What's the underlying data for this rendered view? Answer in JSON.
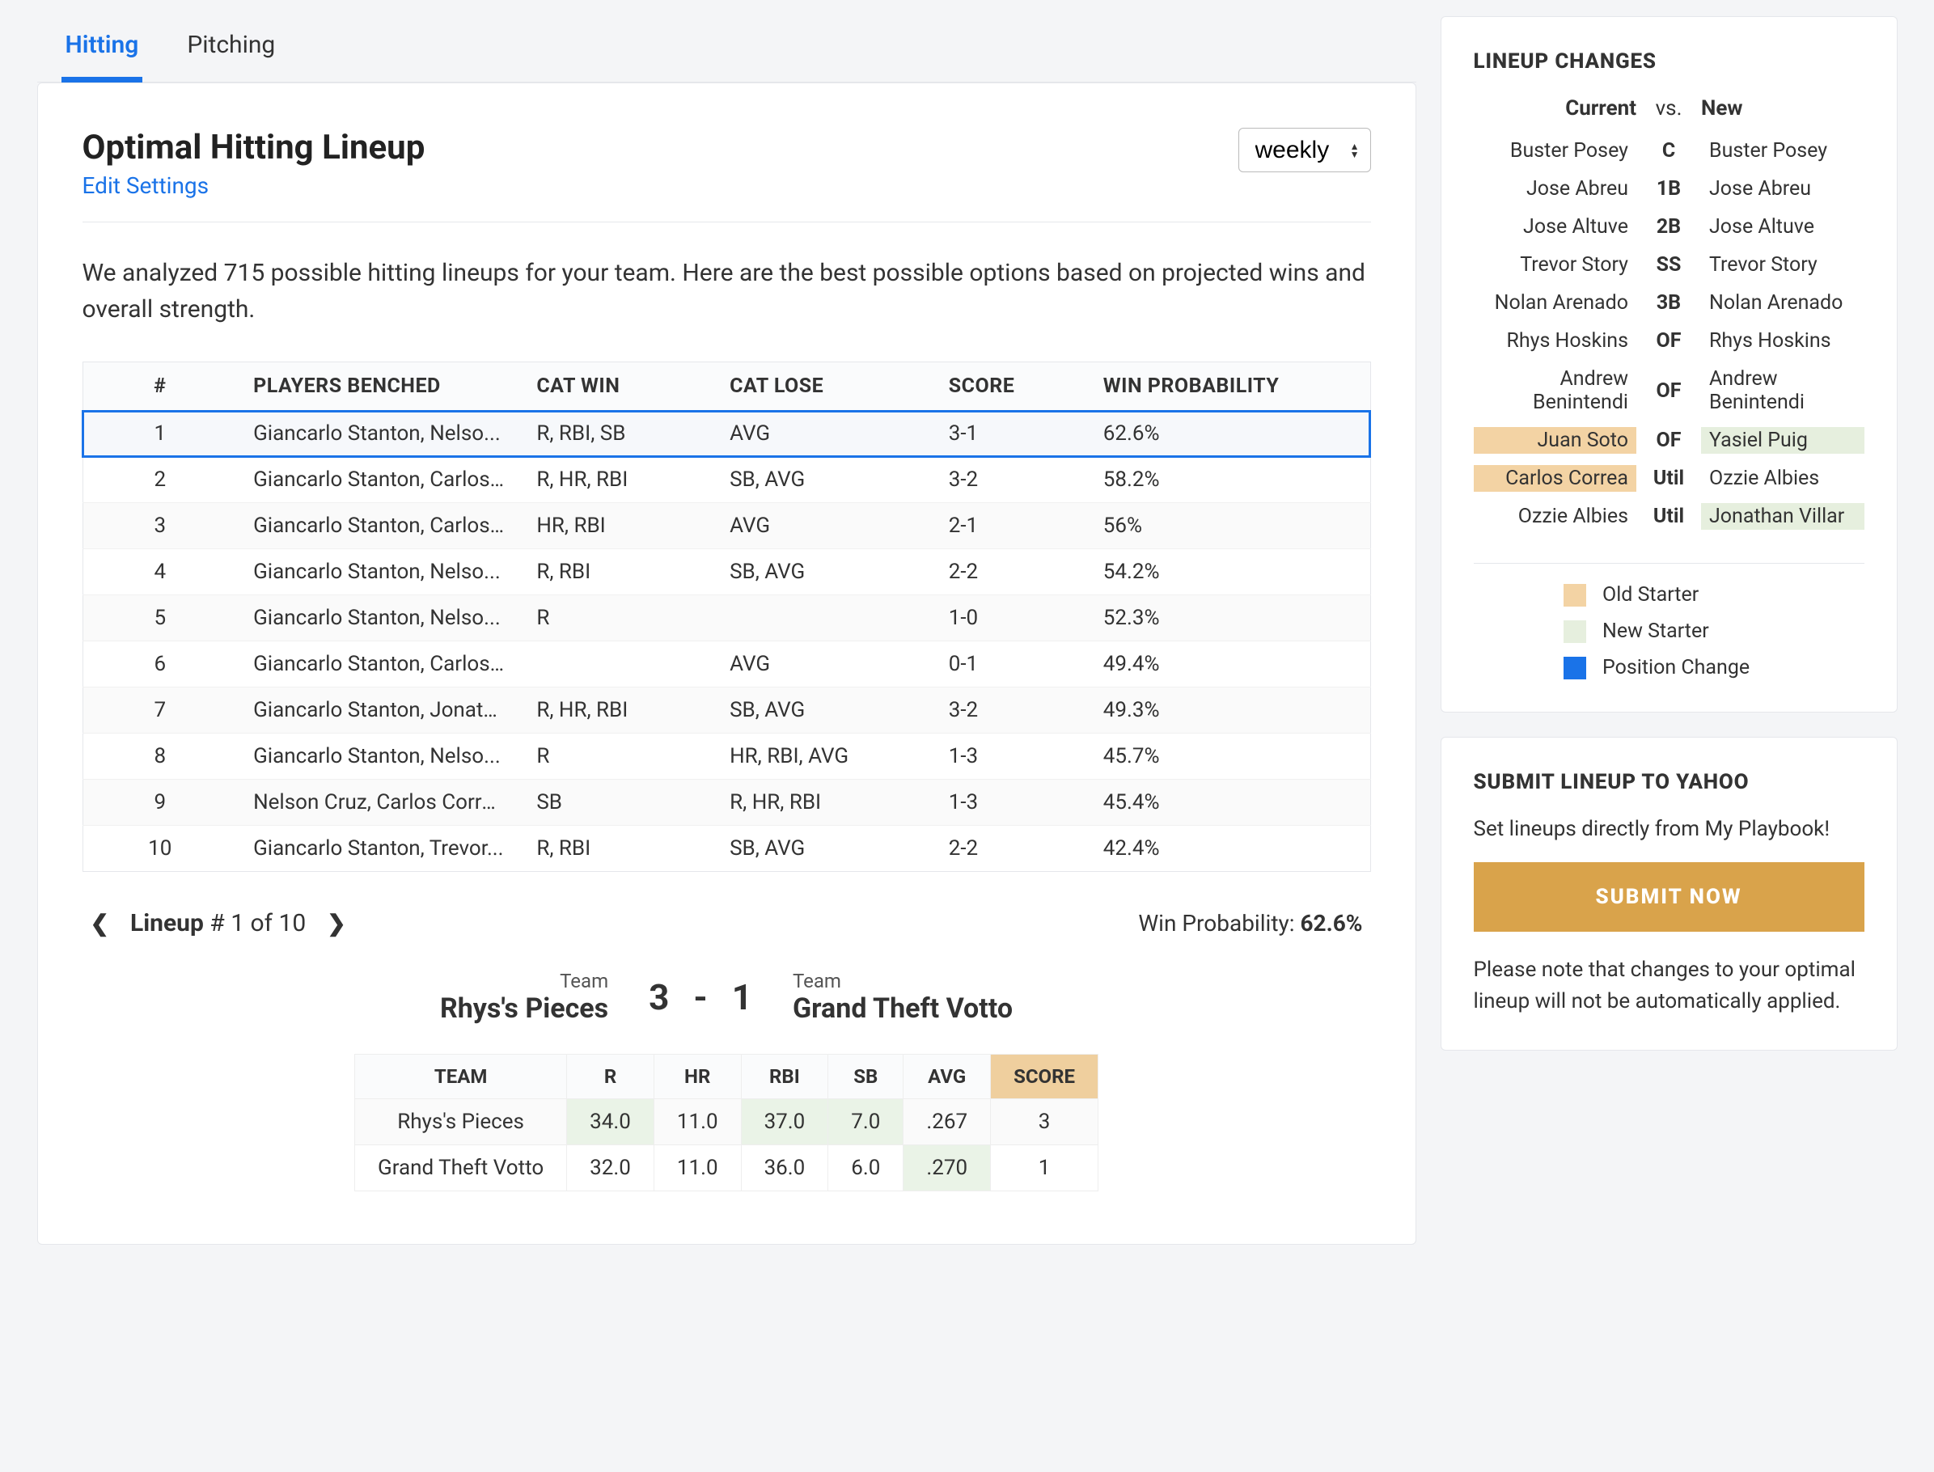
{
  "tabs": {
    "hitting": "Hitting",
    "pitching": "Pitching"
  },
  "title": "Optimal Hitting Lineup",
  "edit_link": "Edit Settings",
  "frequency": "weekly",
  "analysis_text": "We analyzed 715 possible hitting lineups for your team. Here are the best possible options based on projected wins and overall strength.",
  "table": {
    "headers": {
      "num": "#",
      "players": "PLAYERS BENCHED",
      "win": "CAT WIN",
      "lose": "CAT LOSE",
      "score": "SCORE",
      "prob": "WIN PROBABILITY"
    },
    "rows": [
      {
        "num": "1",
        "players": "Giancarlo Stanton, Nelso...",
        "win": "R, RBI, SB",
        "lose": "AVG",
        "score": "3-1",
        "prob": "62.6%"
      },
      {
        "num": "2",
        "players": "Giancarlo Stanton, Carlos...",
        "win": "R, HR, RBI",
        "lose": "SB, AVG",
        "score": "3-2",
        "prob": "58.2%"
      },
      {
        "num": "3",
        "players": "Giancarlo Stanton, Carlos...",
        "win": "HR, RBI",
        "lose": "AVG",
        "score": "2-1",
        "prob": "56%"
      },
      {
        "num": "4",
        "players": "Giancarlo Stanton, Nelso...",
        "win": "R, RBI",
        "lose": "SB, AVG",
        "score": "2-2",
        "prob": "54.2%"
      },
      {
        "num": "5",
        "players": "Giancarlo Stanton, Nelso...",
        "win": "R",
        "lose": "",
        "score": "1-0",
        "prob": "52.3%"
      },
      {
        "num": "6",
        "players": "Giancarlo Stanton, Carlos...",
        "win": "",
        "lose": "AVG",
        "score": "0-1",
        "prob": "49.4%"
      },
      {
        "num": "7",
        "players": "Giancarlo Stanton, Jonath...",
        "win": "R, HR, RBI",
        "lose": "SB, AVG",
        "score": "3-2",
        "prob": "49.3%"
      },
      {
        "num": "8",
        "players": "Giancarlo Stanton, Nelso...",
        "win": "R",
        "lose": "HR, RBI, AVG",
        "score": "1-3",
        "prob": "45.7%"
      },
      {
        "num": "9",
        "players": "Nelson Cruz, Carlos Corre...",
        "win": "SB",
        "lose": "R, HR, RBI",
        "score": "1-3",
        "prob": "45.4%"
      },
      {
        "num": "10",
        "players": "Giancarlo Stanton, Trevor...",
        "win": "R, RBI",
        "lose": "SB, AVG",
        "score": "2-2",
        "prob": "42.4%"
      }
    ]
  },
  "nav": {
    "label": "Lineup",
    "counter": "# 1 of 10",
    "wp_label": "Win Probability:",
    "wp_value": "62.6%"
  },
  "matchup": {
    "team_label": "Team",
    "left_name": "Rhys's Pieces",
    "left_score": "3",
    "dash": "-",
    "right_name": "Grand Theft Votto",
    "right_score": "1"
  },
  "stats": {
    "headers": {
      "team": "TEAM",
      "r": "R",
      "hr": "HR",
      "rbi": "RBI",
      "sb": "SB",
      "avg": "AVG",
      "score": "SCORE"
    },
    "rows": [
      {
        "team": "Rhys's Pieces",
        "r": "34.0",
        "hr": "11.0",
        "rbi": "37.0",
        "sb": "7.0",
        "avg": ".267",
        "score": "3",
        "wins": [
          "r",
          "rbi",
          "sb"
        ]
      },
      {
        "team": "Grand Theft Votto",
        "r": "32.0",
        "hr": "11.0",
        "rbi": "36.0",
        "sb": "6.0",
        "avg": ".270",
        "score": "1",
        "wins": [
          "avg"
        ]
      }
    ]
  },
  "changes": {
    "title": "LINEUP CHANGES",
    "head": {
      "current": "Current",
      "vs": "vs.",
      "new": "New"
    },
    "rows": [
      {
        "cur": "Buster Posey",
        "pos": "C",
        "new": "Buster Posey"
      },
      {
        "cur": "Jose Abreu",
        "pos": "1B",
        "new": "Jose Abreu"
      },
      {
        "cur": "Jose Altuve",
        "pos": "2B",
        "new": "Jose Altuve"
      },
      {
        "cur": "Trevor Story",
        "pos": "SS",
        "new": "Trevor Story"
      },
      {
        "cur": "Nolan Arenado",
        "pos": "3B",
        "new": "Nolan Arenado"
      },
      {
        "cur": "Rhys Hoskins",
        "pos": "OF",
        "new": "Rhys Hoskins"
      },
      {
        "cur": "Andrew Benintendi",
        "pos": "OF",
        "new": "Andrew Benintendi"
      },
      {
        "cur": "Juan Soto",
        "pos": "OF",
        "new": "Yasiel Puig",
        "cur_cls": "old-starter",
        "new_cls": "new-starter"
      },
      {
        "cur": "Carlos Correa",
        "pos": "Util",
        "new": "Ozzie Albies",
        "cur_cls": "old-starter"
      },
      {
        "cur": "Ozzie Albies",
        "pos": "Util",
        "new": "Jonathan Villar",
        "new_cls": "new-starter"
      }
    ],
    "legend": {
      "old": "Old Starter",
      "new": "New Starter",
      "pos": "Position Change"
    }
  },
  "submit": {
    "title": "SUBMIT LINEUP TO YAHOO",
    "desc": "Set lineups directly from My Playbook!",
    "button": "SUBMIT NOW",
    "note": "Please note that changes to your optimal lineup will not be automatically applied."
  }
}
